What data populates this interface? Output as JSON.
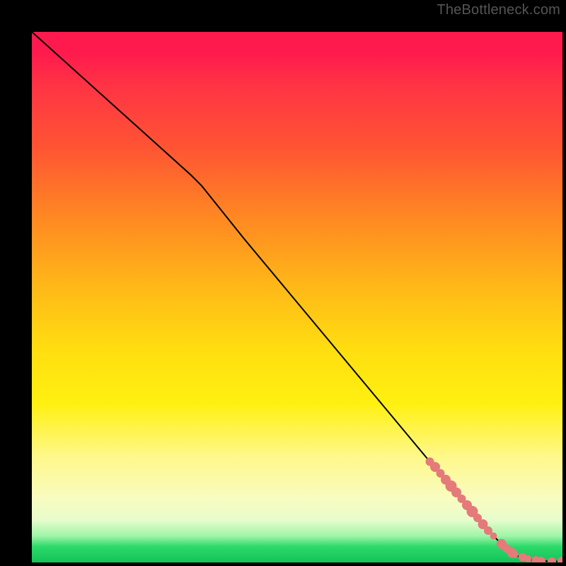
{
  "watermark": "TheBottleneck.com",
  "colors": {
    "marker_fill": "#e47a7a",
    "curve_stroke": "#000000"
  },
  "chart_data": {
    "type": "line",
    "title": "",
    "xlabel": "",
    "ylabel": "",
    "xlim": [
      0,
      100
    ],
    "ylim": [
      0,
      100
    ],
    "grid": false,
    "legend": false,
    "curve": {
      "x": [
        0,
        10,
        20,
        30,
        32,
        40,
        50,
        60,
        70,
        75,
        80,
        85,
        88,
        90,
        92,
        94,
        96,
        98,
        100
      ],
      "y": [
        100,
        91,
        82,
        73,
        71,
        61,
        49,
        37,
        25,
        19,
        13,
        7,
        4,
        2,
        1,
        0.5,
        0.3,
        0.2,
        0.2
      ]
    },
    "markers": {
      "comment": "highlighted data points (pink dots) cluster along the tail of the curve",
      "x": [
        75,
        76,
        77,
        78,
        79,
        80,
        81,
        82,
        83,
        84,
        85,
        86,
        87,
        88.5,
        89,
        89.5,
        90.5,
        91,
        92.5,
        93.5,
        95,
        96,
        98,
        100
      ],
      "y": [
        19,
        18,
        16.8,
        15.6,
        14.4,
        13.2,
        12,
        10.8,
        9.6,
        8.4,
        7.2,
        6,
        5,
        3.5,
        3,
        2.6,
        1.8,
        1.5,
        1,
        0.7,
        0.4,
        0.3,
        0.2,
        0.2
      ],
      "r": [
        6,
        7,
        6,
        7,
        8,
        7,
        6,
        7,
        8,
        6,
        7,
        6,
        5,
        7,
        5,
        6,
        7,
        5,
        6,
        5,
        6,
        6,
        6,
        7
      ]
    }
  }
}
